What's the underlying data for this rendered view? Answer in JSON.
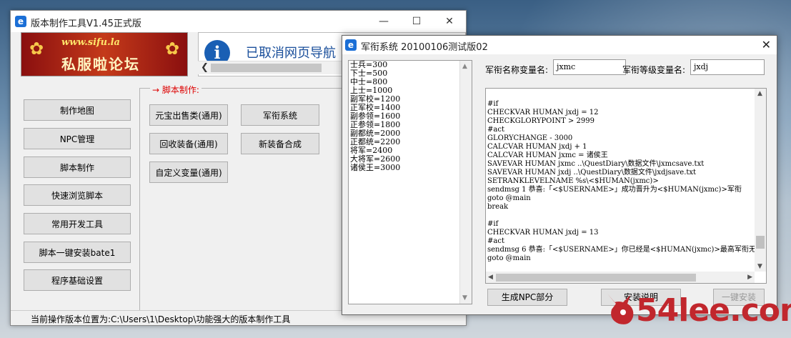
{
  "main_window": {
    "title": "版本制作工具V1.45正式版",
    "controls": {
      "minimize": "—",
      "maximize": "☐",
      "close": "✕"
    },
    "banner": {
      "url": "www.sifu.la",
      "name": "私服啦论坛"
    },
    "browser_text": "已取消网页导航",
    "left_buttons": [
      "制作地图",
      "NPC管理",
      "脚本制作",
      "快速浏览脚本",
      "常用开发工具",
      "脚本一键安装bate1",
      "程序基础设置"
    ],
    "script_section_label": "→ 脚本制作:",
    "script_buttons": {
      "yuanbao": "元宝出售类(通用)",
      "rank": "军衔系统",
      "recycle": "回收装备(通用)",
      "new_equip": "新装备合成",
      "custom_var": "自定义变量(通用)"
    },
    "status_text": "当前操作版本位置为:C:\\Users\\1\\Desktop\\功能强大的版本制作工具"
  },
  "rank_window": {
    "title": "军衔系统 20100106测试版02",
    "close": "✕",
    "rank_list": [
      "士兵=300",
      "下士=500",
      "中士=800",
      "上士=1000",
      "副军校=1200",
      "正军校=1400",
      "副参领=1600",
      "正参领=1800",
      "副都统=2000",
      "正都统=2200",
      "将军=2400",
      "大将军=2600",
      "诸侯王=3000"
    ],
    "name_var_label": "军衔名称变量名:",
    "name_var_value": "jxmc",
    "level_var_label": "军衔等级变量名:",
    "level_var_value": "jxdj",
    "code_lines": [
      "#if",
      "CHECKVAR HUMAN jxdj = 12",
      "CHECKGLORYPOINT > 2999",
      "#act",
      "GLORYCHANGE - 3000",
      "CALCVAR HUMAN jxdj + 1",
      "CALCVAR HUMAN jxmc = 诸侯王",
      "SAVEVAR HUMAN jxmc ..\\QuestDiary\\数据文件\\jxmcsave.txt",
      "SAVEVAR HUMAN jxdj ..\\QuestDiary\\数据文件\\jxdjsave.txt",
      "SETRANKLEVELNAME %s\\<$HUMAN(jxmc)>",
      "sendmsg 1 恭喜:「<$USERNAME>」成功晋升为<$HUMAN(jxmc)>军衔",
      "goto @main",
      "break",
      "",
      "#if",
      "CHECKVAR HUMAN jxdj = 13",
      "#act",
      "sendmsg 6 恭喜:「<$USERNAME>」你已经是<$HUMAN(jxmc)>最高军衔无",
      "goto @main"
    ],
    "buttons": {
      "generate": "生成NPC部分",
      "install_guide": "安装说明",
      "one_click": "一键安装"
    }
  },
  "watermark": {
    "text": "54lee.com"
  },
  "colors": {
    "accent_red": "#d00000",
    "brand_blue": "#1a5fb4",
    "watermark_red": "#c1272d"
  }
}
